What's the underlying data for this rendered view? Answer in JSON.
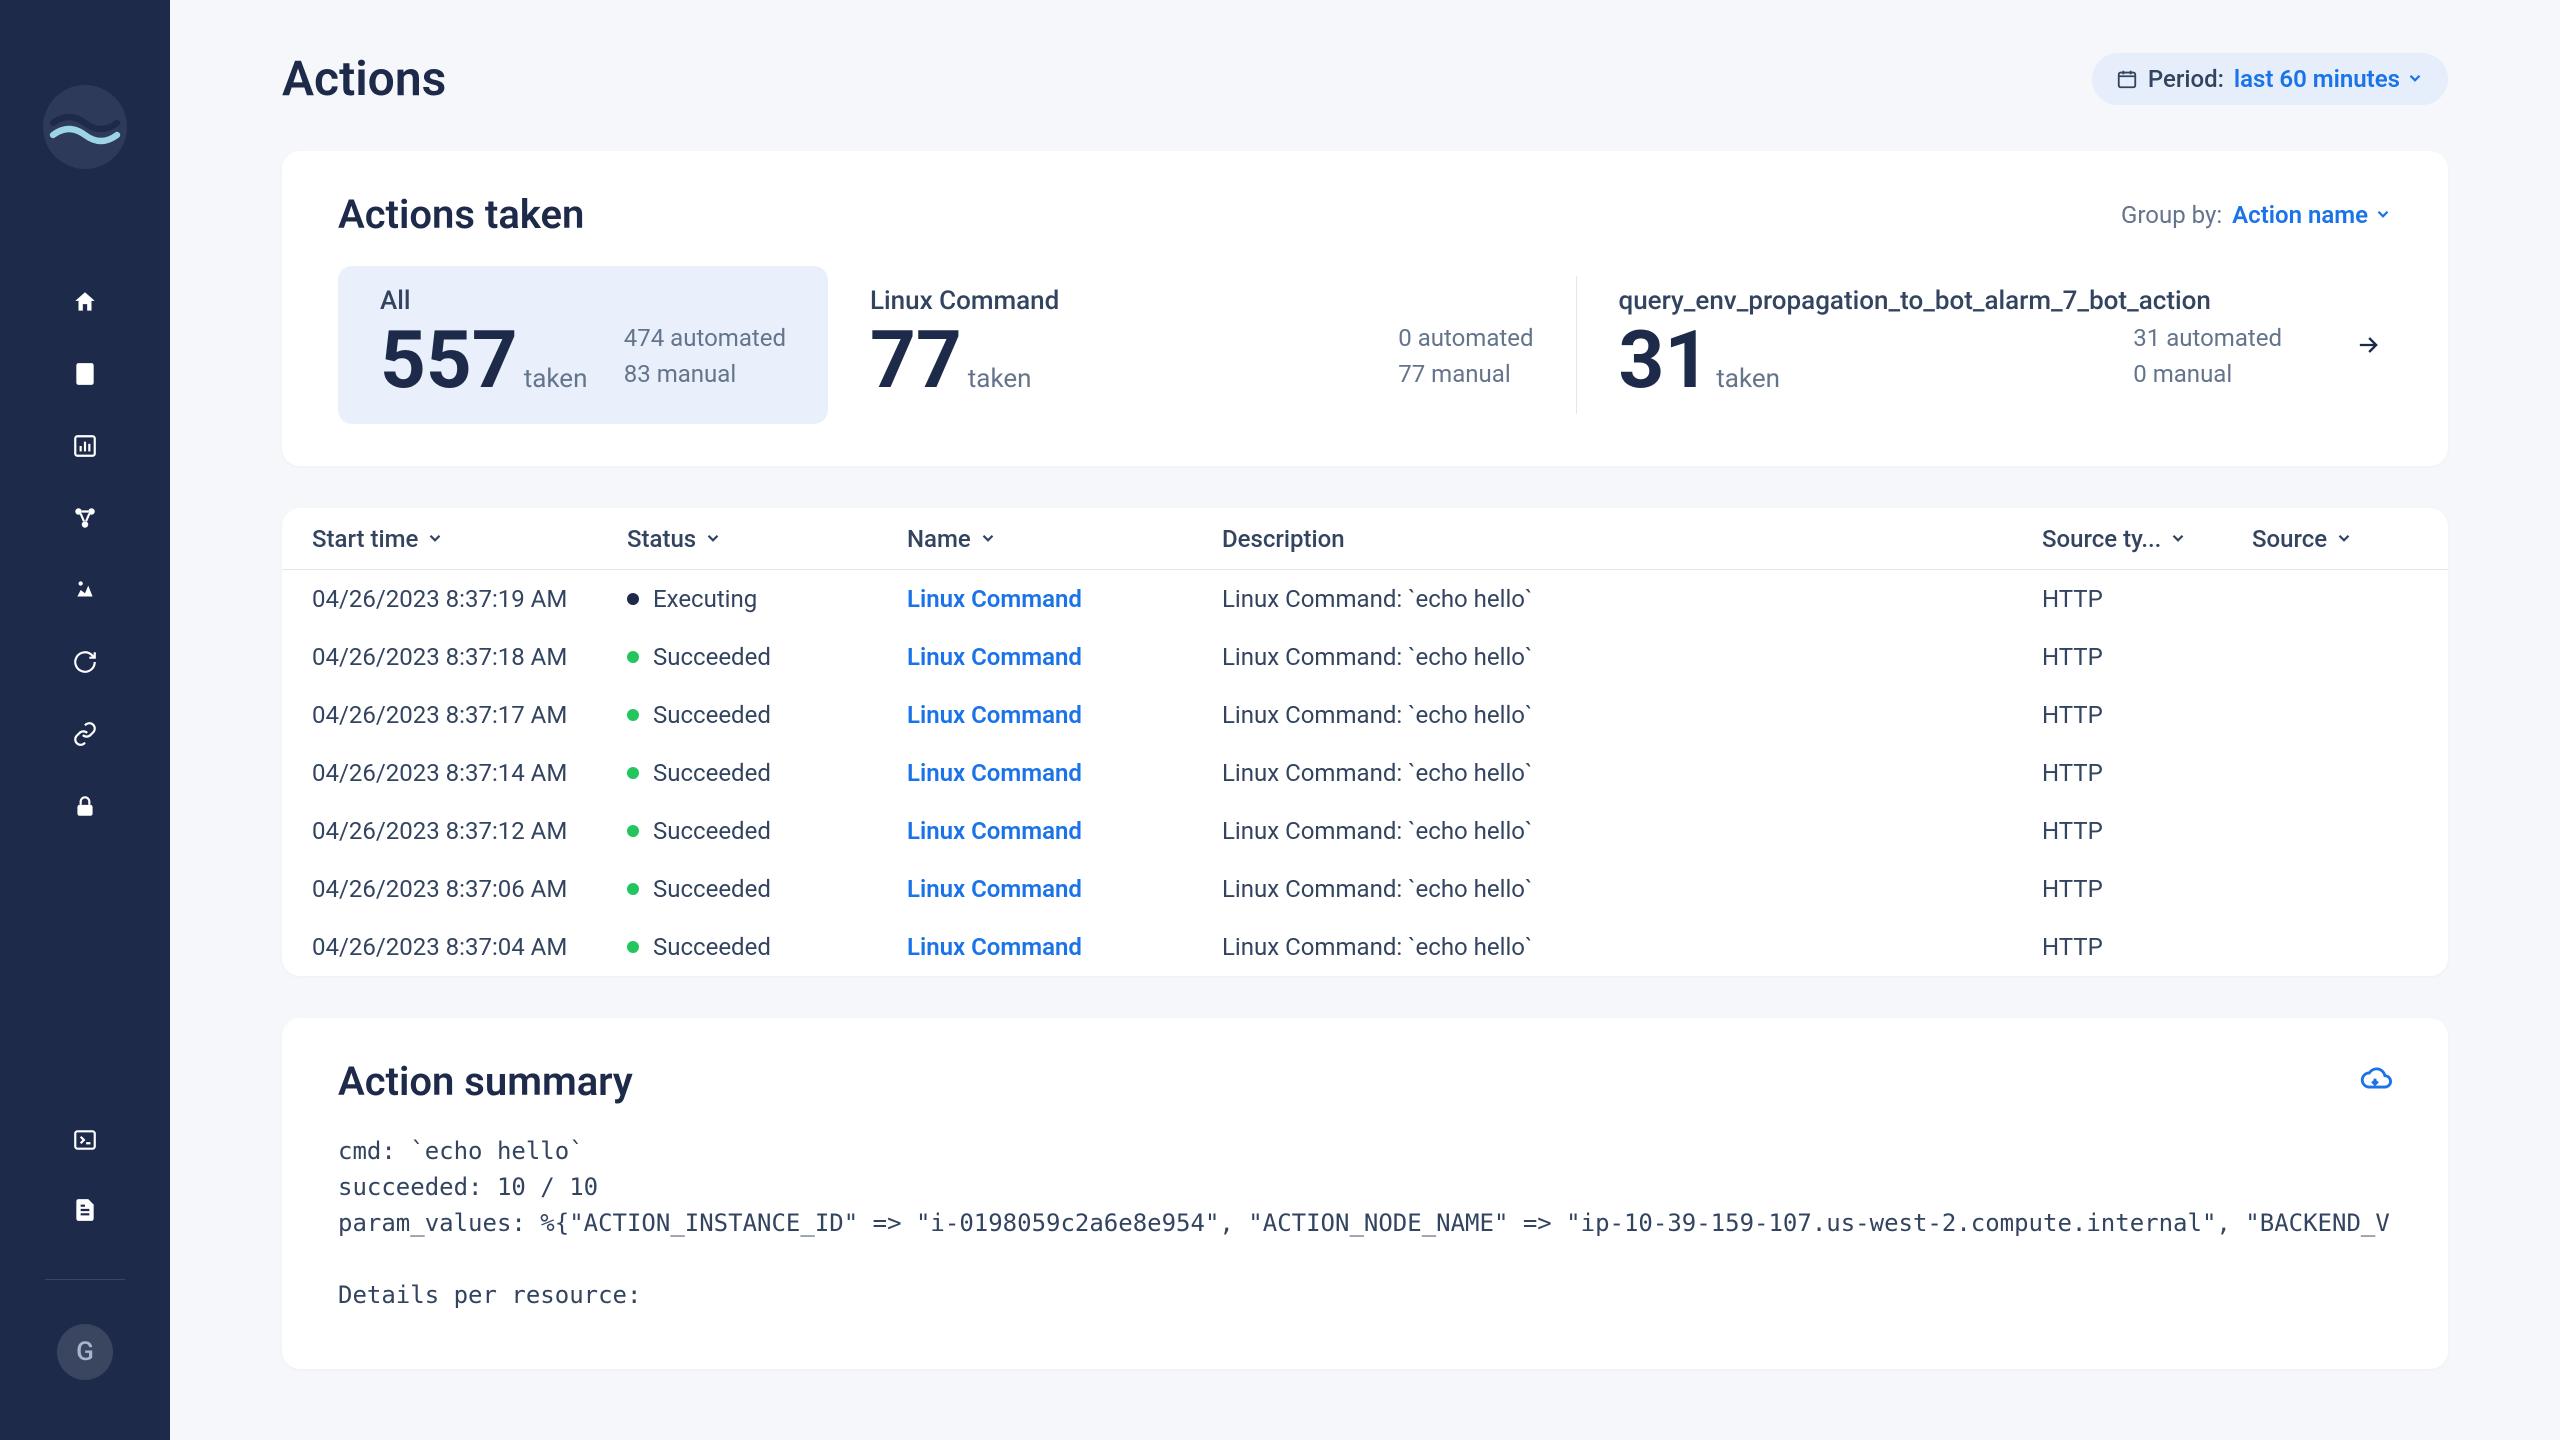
{
  "page": {
    "title": "Actions"
  },
  "period": {
    "label": "Period:",
    "value": "last 60 minutes"
  },
  "actions_taken": {
    "title": "Actions taken",
    "group_by_label": "Group by:",
    "group_by_value": "Action name",
    "cards": [
      {
        "name": "All",
        "count": "557",
        "suffix": "taken",
        "meta1": "474 automated",
        "meta2": "83 manual",
        "active": true
      },
      {
        "name": "Linux Command",
        "count": "77",
        "suffix": "taken",
        "meta1": "0 automated",
        "meta2": "77 manual",
        "active": false
      },
      {
        "name": "query_env_propagation_to_bot_alarm_7_bot_action",
        "count": "31",
        "suffix": "taken",
        "meta1": "31 automated",
        "meta2": "0 manual",
        "active": false
      }
    ]
  },
  "table": {
    "headers": {
      "start": "Start time",
      "status": "Status",
      "name": "Name",
      "desc": "Description",
      "stype": "Source ty...",
      "source": "Source"
    },
    "rows": [
      {
        "start": "04/26/2023 8:37:19 AM",
        "status": "Executing",
        "status_kind": "exec",
        "name": "Linux Command",
        "desc": "Linux Command: `echo hello`",
        "stype": "HTTP",
        "source": ""
      },
      {
        "start": "04/26/2023 8:37:18 AM",
        "status": "Succeeded",
        "status_kind": "ok",
        "name": "Linux Command",
        "desc": "Linux Command: `echo hello`",
        "stype": "HTTP",
        "source": ""
      },
      {
        "start": "04/26/2023 8:37:17 AM",
        "status": "Succeeded",
        "status_kind": "ok",
        "name": "Linux Command",
        "desc": "Linux Command: `echo hello`",
        "stype": "HTTP",
        "source": ""
      },
      {
        "start": "04/26/2023 8:37:14 AM",
        "status": "Succeeded",
        "status_kind": "ok",
        "name": "Linux Command",
        "desc": "Linux Command: `echo hello`",
        "stype": "HTTP",
        "source": ""
      },
      {
        "start": "04/26/2023 8:37:12 AM",
        "status": "Succeeded",
        "status_kind": "ok",
        "name": "Linux Command",
        "desc": "Linux Command: `echo hello`",
        "stype": "HTTP",
        "source": ""
      },
      {
        "start": "04/26/2023 8:37:06 AM",
        "status": "Succeeded",
        "status_kind": "ok",
        "name": "Linux Command",
        "desc": "Linux Command: `echo hello`",
        "stype": "HTTP",
        "source": ""
      },
      {
        "start": "04/26/2023 8:37:04 AM",
        "status": "Succeeded",
        "status_kind": "ok",
        "name": "Linux Command",
        "desc": "Linux Command: `echo hello`",
        "stype": "HTTP",
        "source": ""
      }
    ]
  },
  "summary": {
    "title": "Action summary",
    "text": "cmd: `echo hello`\nsucceeded: 10 / 10\nparam_values: %{\"ACTION_INSTANCE_ID\" => \"i-0198059c2a6e8e954\", \"ACTION_NODE_NAME\" => \"ip-10-39-159-107.us-west-2.compute.internal\", \"BACKEND_VERSION\" =>\n\nDetails per resource:"
  },
  "avatar": "G"
}
